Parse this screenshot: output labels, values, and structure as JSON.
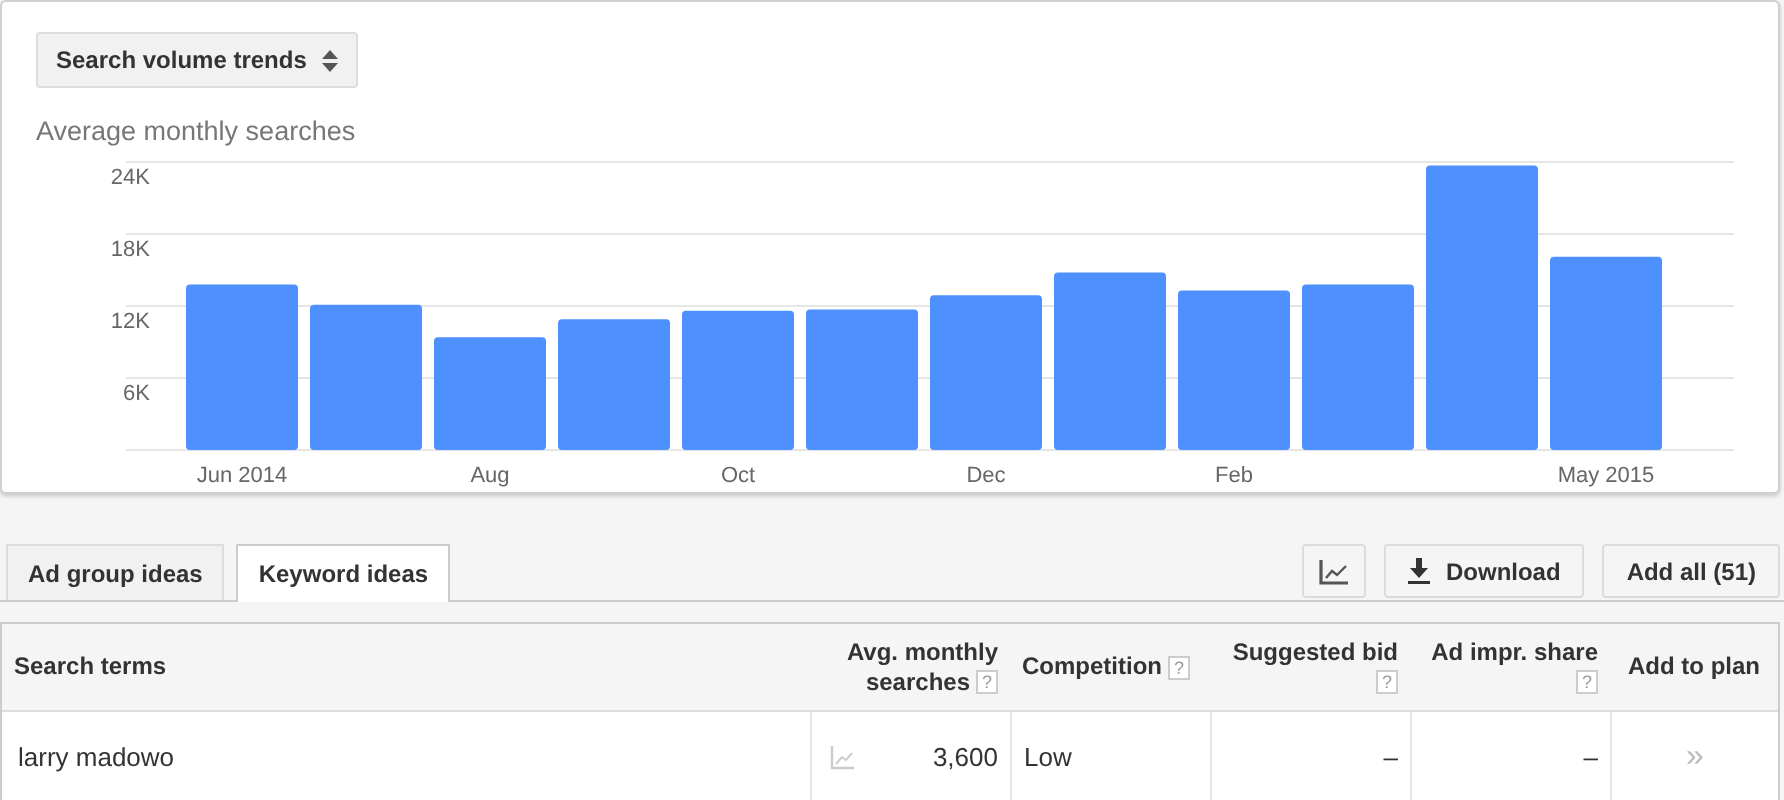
{
  "chart_card": {
    "selector": {
      "label": "Search volume trends"
    },
    "chart_data": {
      "type": "bar",
      "title": "Average monthly searches",
      "grid": true,
      "series": [
        {
          "color": "#4d90fe",
          "values": [
            13800,
            12100,
            9400,
            10900,
            11600,
            11700,
            12900,
            14800,
            13300,
            13800,
            23700,
            16100
          ]
        }
      ],
      "ylim": [
        0,
        24000
      ],
      "yticks": [
        {
          "value": 6000,
          "label": "6K"
        },
        {
          "value": 12000,
          "label": "12K"
        },
        {
          "value": 18000,
          "label": "18K"
        },
        {
          "value": 24000,
          "label": "24K"
        }
      ],
      "categories": [
        "Jun 2014",
        null,
        "Aug",
        null,
        "Oct",
        null,
        "Dec",
        null,
        "Feb",
        null,
        null,
        "May 2015"
      ]
    }
  },
  "tabs": [
    {
      "label": "Ad group ideas",
      "selected": false
    },
    {
      "label": "Keyword ideas",
      "selected": true
    }
  ],
  "toolbar": {
    "download": "Download",
    "add_all": "Add all (51)"
  },
  "table": {
    "columns": [
      {
        "label": "Search terms"
      },
      {
        "label": "Avg. monthly searches",
        "help": "?"
      },
      {
        "label": "Competition",
        "help": "?"
      },
      {
        "label": "Suggested bid",
        "help": "?"
      },
      {
        "label": "Ad impr. share",
        "help": "?"
      },
      {
        "label": "Add to plan"
      }
    ],
    "rows": [
      {
        "search_term": "larry madowo",
        "avg_monthly_searches": "3,600",
        "competition": "Low",
        "suggested_bid": "–",
        "ad_impr_share": "–",
        "add": "»"
      }
    ]
  }
}
